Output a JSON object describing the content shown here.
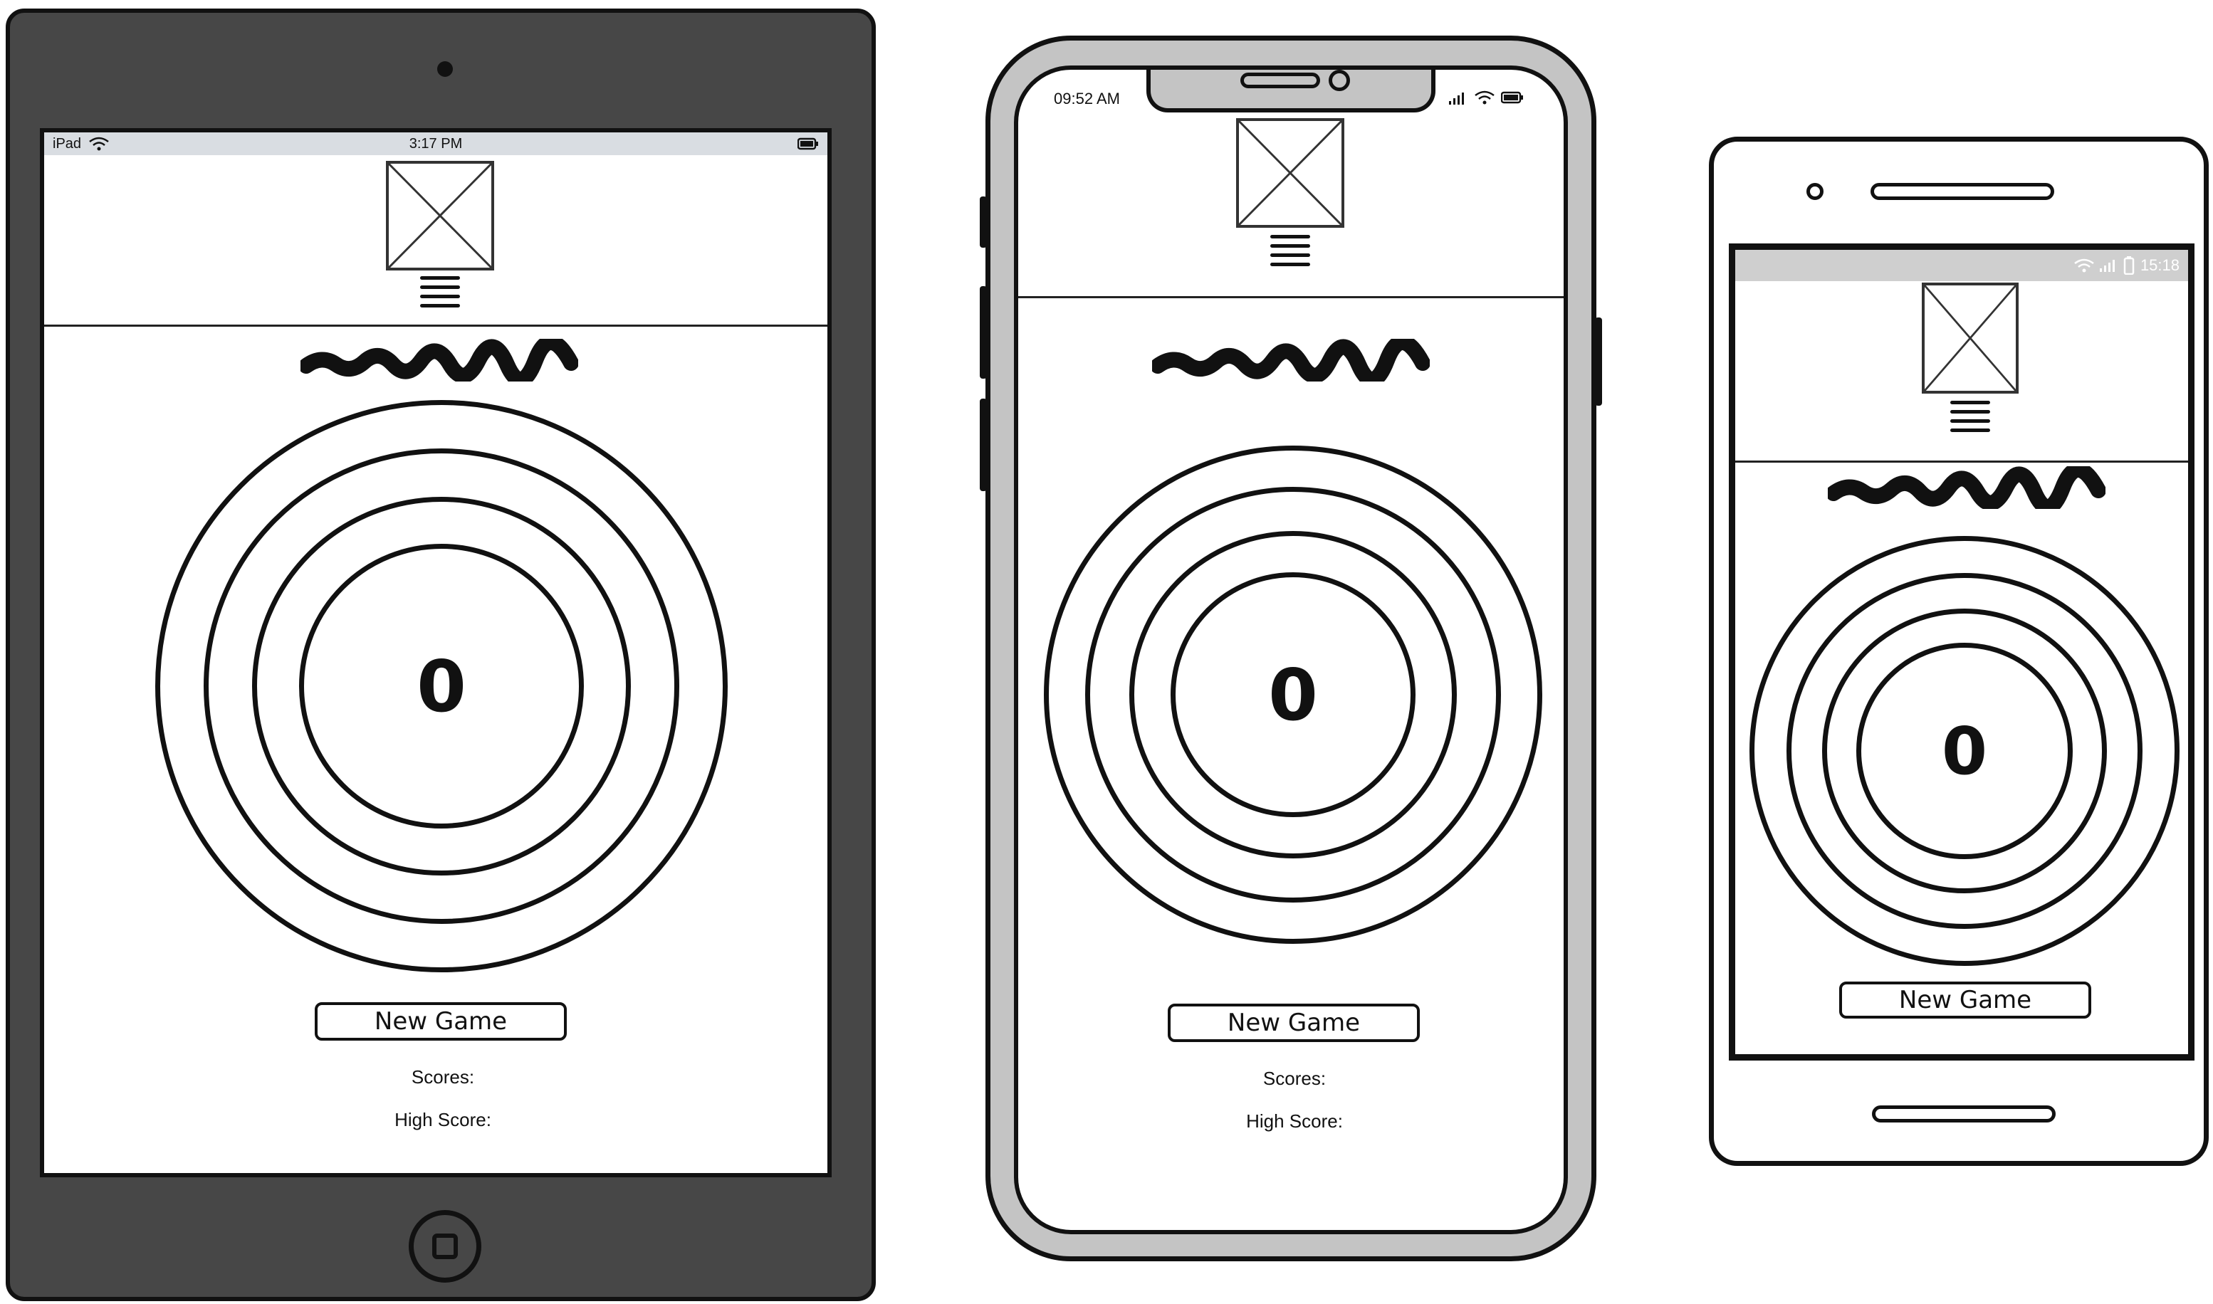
{
  "ipad": {
    "status": {
      "carrier": "iPad",
      "time": "3:17 PM"
    },
    "score_value": "0",
    "new_game_label": "New Game",
    "scores_label": "Scores:",
    "high_score_label": "High Score:"
  },
  "iphone": {
    "status": {
      "time": "09:52 AM"
    },
    "score_value": "0",
    "new_game_label": "New Game",
    "scores_label": "Scores:",
    "high_score_label": "High Score:"
  },
  "android": {
    "status": {
      "time": "15:18"
    },
    "score_value": "0",
    "new_game_label": "New Game"
  },
  "colors": {
    "ipad_bezel": "#474747",
    "iphone_bezel": "#c4c4c4",
    "ipad_statusbar": "#d9dde2",
    "android_statusbar": "#cfcfcf",
    "ink": "#111111"
  }
}
